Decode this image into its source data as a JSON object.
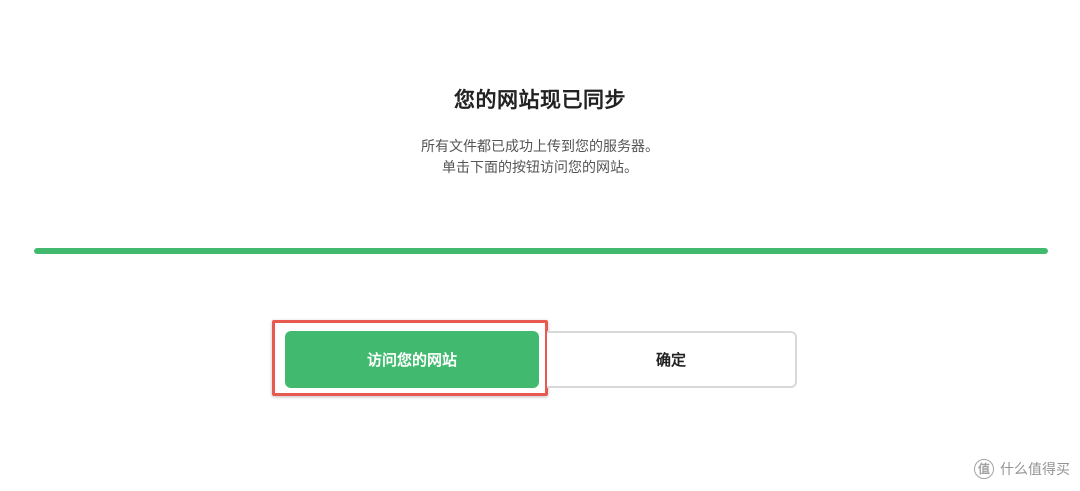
{
  "dialog": {
    "title": "您的网站现已同步",
    "description_line1": "所有文件都已成功上传到您的服务器。",
    "description_line2": "单击下面的按钮访问您的网站。"
  },
  "progress": {
    "value": 1.0,
    "fill_color": "#41b96e"
  },
  "actions": {
    "visit_label": "访问您的网站",
    "ok_label": "确定",
    "primary_color": "#41b96e",
    "highlight_color": "#e85a4f"
  },
  "watermark": {
    "icon": "zhi-icon",
    "text": "什么值得买"
  }
}
